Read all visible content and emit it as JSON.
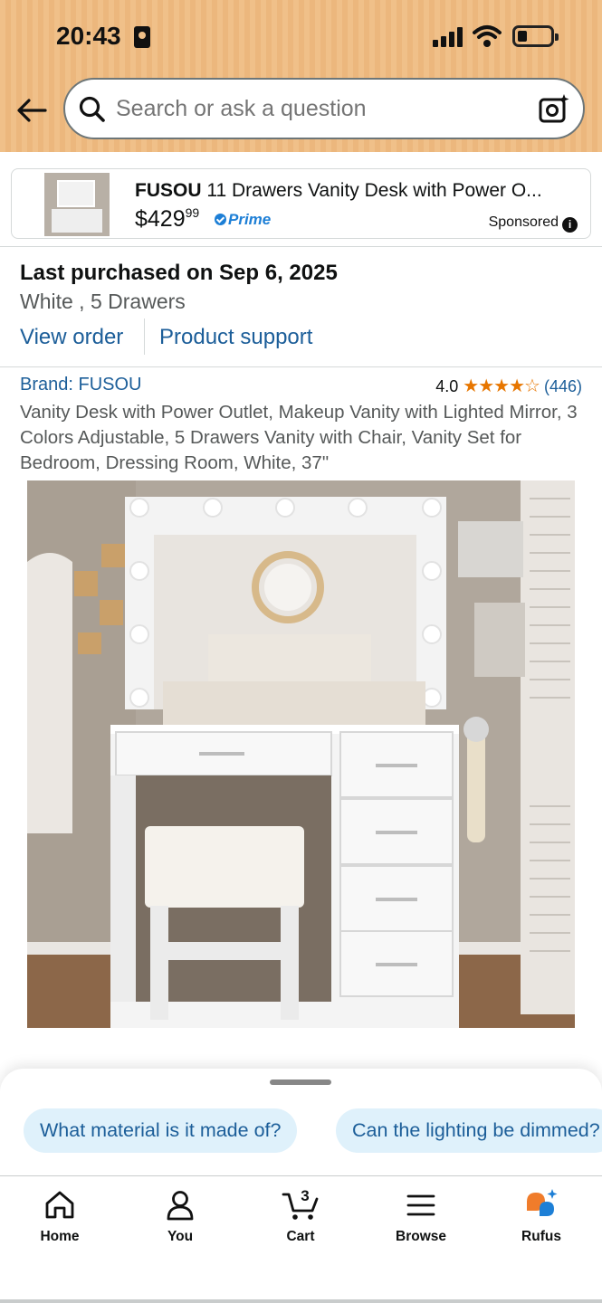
{
  "status_bar": {
    "time": "20:43"
  },
  "search": {
    "placeholder": "Search or ask a question"
  },
  "sponsored": {
    "brand": "FUSOU",
    "title": "11 Drawers Vanity Desk with Power O...",
    "price_dollars": "$429",
    "price_cents": "99",
    "prime_label": "Prime",
    "sponsored_label": "Sponsored"
  },
  "purchase": {
    "title": "Last purchased on Sep 6, 2025",
    "variant": "White , 5 Drawers",
    "view_order": "View order",
    "product_support": "Product support"
  },
  "product": {
    "brand": "Brand: FUSOU",
    "rating_value": "4.0",
    "stars": "★★★★☆",
    "review_count": "(446)",
    "description": "Vanity Desk with Power Outlet, Makeup Vanity with Lighted Mirror, 3 Colors Adjustable, 5 Drawers Vanity with Chair, Vanity Set for Bedroom, Dressing Room, White, 37\""
  },
  "rufus_chips": [
    "What material is it made of?",
    "Can the lighting be dimmed?"
  ],
  "nav": {
    "home": "Home",
    "you": "You",
    "cart": "Cart",
    "cart_count": "3",
    "browse": "Browse",
    "rufus": "Rufus"
  },
  "colors": {
    "header": "#f0c089",
    "link": "#1c5e99",
    "star": "#e77600",
    "prime": "#1d7fd6",
    "chip_bg": "#dff1fb"
  }
}
